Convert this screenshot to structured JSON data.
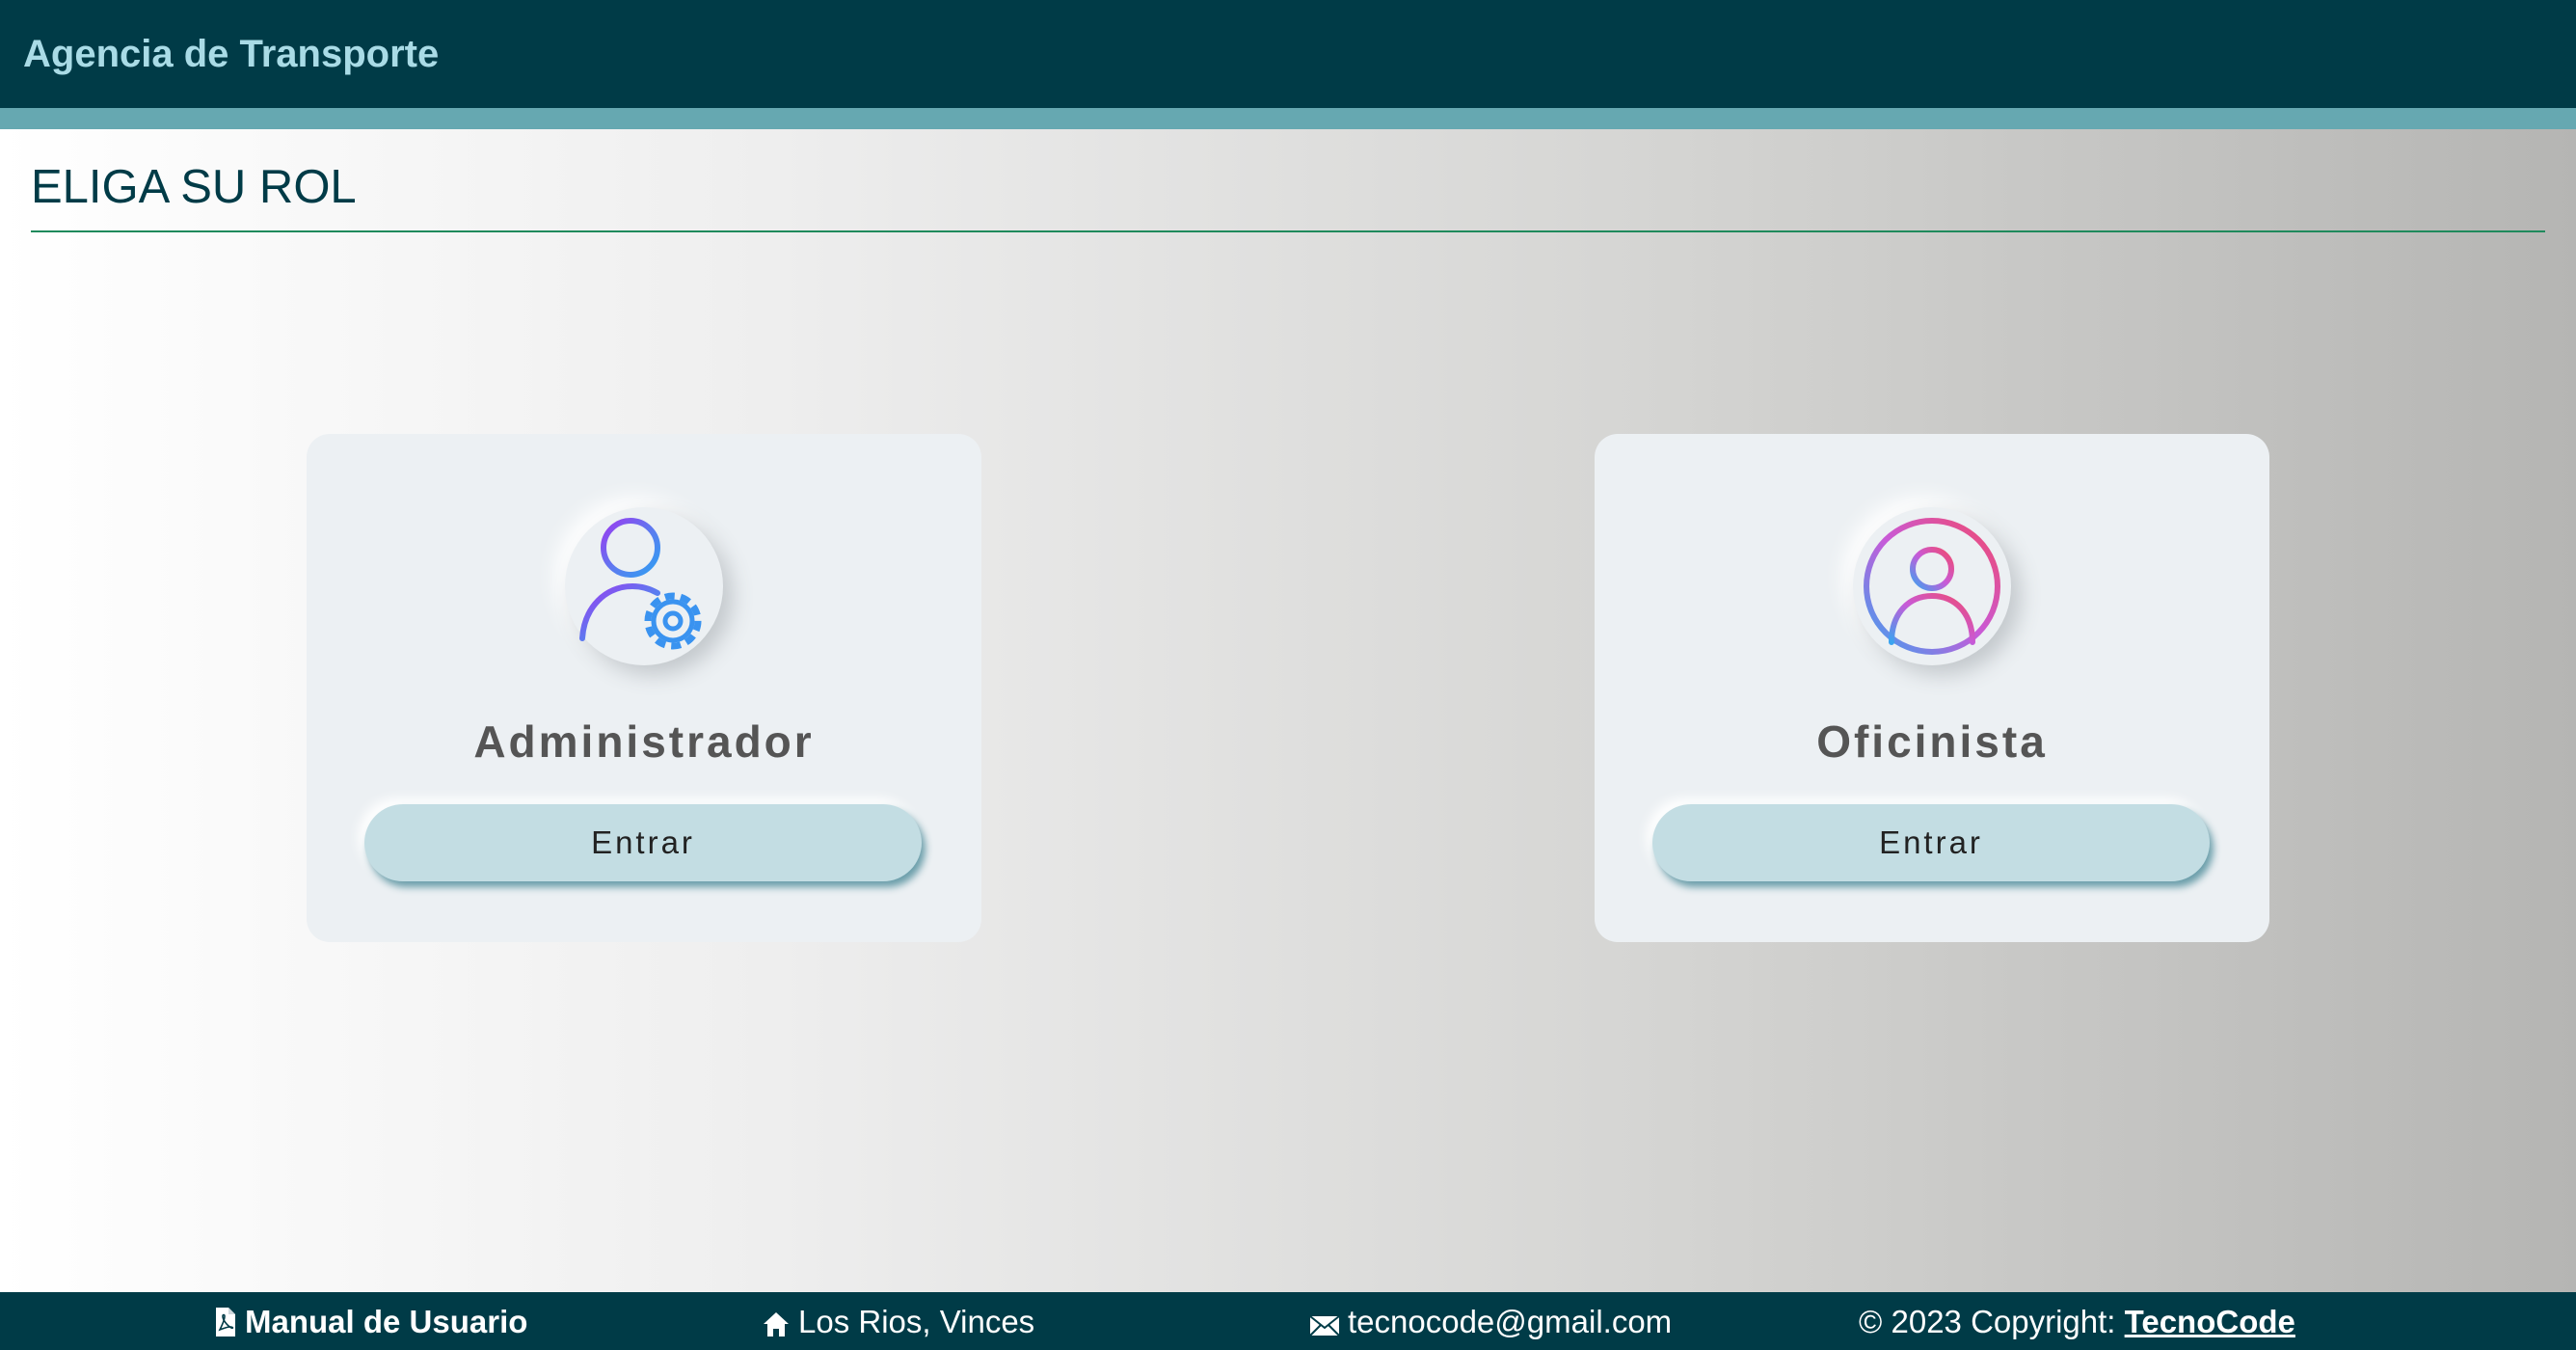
{
  "header": {
    "title": "Agencia de Transporte",
    "background_color": "#003b47",
    "accent_color": "#66a8b1"
  },
  "main": {
    "page_title": "ELIGA SU ROL",
    "roles": [
      {
        "name": "Administrador",
        "icon": "user-gear-icon",
        "button_label": "Entrar"
      },
      {
        "name": "Oficinista",
        "icon": "user-circle-icon",
        "button_label": "Entrar"
      }
    ]
  },
  "footer": {
    "manual_label": "Manual de Usuario",
    "manual_icon": "pdf-file-icon",
    "location": "Los Rios, Vinces",
    "location_icon": "home-icon",
    "email": "tecnocode@gmail.com",
    "email_icon": "envelope-icon",
    "copyright_text": "© 2023 Copyright: ",
    "copyright_link": "TecnoCode"
  }
}
